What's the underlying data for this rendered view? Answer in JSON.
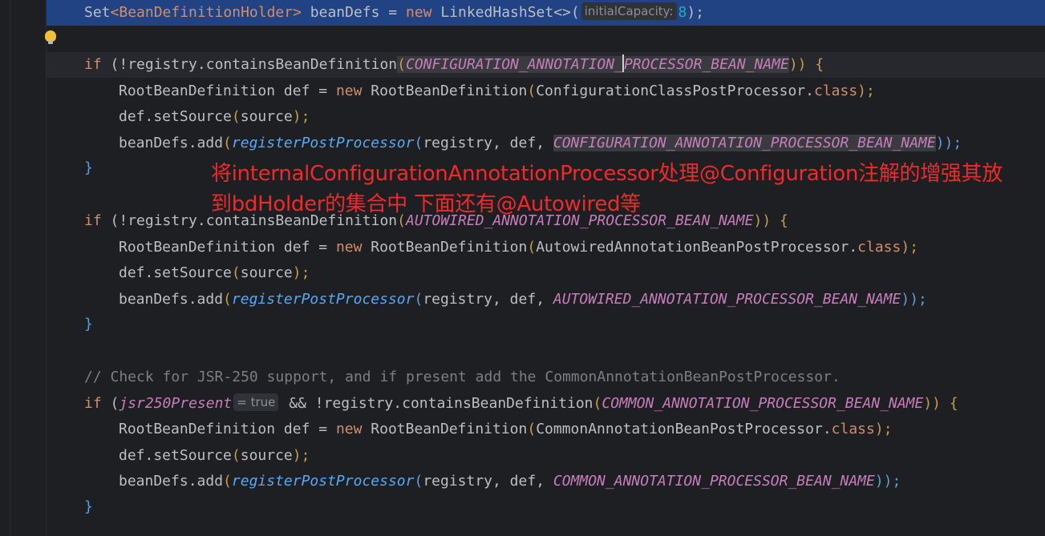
{
  "code": {
    "line1": {
      "set": "Set",
      "generic": "<BeanDefinitionHolder>",
      "decl": " beanDefs = ",
      "new": "new",
      "cls": " LinkedHashSet<>(",
      "hint": "initialCapacity:",
      "num": "8",
      "end": ");"
    },
    "block1": {
      "if": "if",
      "cond_pre": " (!registry.containsBeanDefinition",
      "open": "(",
      "const_a": "CONFIGURATION_ANNOTATION_",
      "const_b": "PROCESSOR_BEAN_NAME",
      "close": ")) {",
      "def_pre": "RootBeanDefinition def = ",
      "new": "new",
      "def_cls": " RootBeanDefinition",
      "def_arg": "ConfigurationClassPostProcessor.",
      "class_kw": "class",
      "def_end": ");",
      "source": "def.setSource",
      "source_arg": "source",
      "source_end": ");",
      "add_pre": "beanDefs.add",
      "reg_fn": "registerPostProcessor",
      "reg_args": "registry, def, ",
      "reg_const": "CONFIGURATION_ANNOTATION_PROCESSOR_BEAN_NAME",
      "add_end": "));",
      "brace": "}"
    },
    "block2": {
      "if": "if",
      "cond_pre": " (!registry.containsBeanDefinition",
      "const": "AUTOWIRED_ANNOTATION_PROCESSOR_BEAN_NAME",
      "close": ")) {",
      "def_pre": "RootBeanDefinition def = ",
      "new": "new",
      "def_cls": " RootBeanDefinition",
      "def_arg": "AutowiredAnnotationBeanPostProcessor.",
      "class_kw": "class",
      "def_end": ");",
      "source": "def.setSource",
      "source_arg": "source",
      "source_end": ");",
      "add_pre": "beanDefs.add",
      "reg_fn": "registerPostProcessor",
      "reg_args": "registry, def, ",
      "reg_const": "AUTOWIRED_ANNOTATION_PROCESSOR_BEAN_NAME",
      "add_end": "));",
      "brace": "}"
    },
    "comment": "// Check for JSR-250 support, and if present add the CommonAnnotationBeanPostProcessor.",
    "block3": {
      "if": "if",
      "jsr": "jsr250Present",
      "hint": "= true",
      "cond_mid": " && !registry.containsBeanDefinition",
      "const": "COMMON_ANNOTATION_PROCESSOR_BEAN_NAME",
      "close": ")) {",
      "def_pre": "RootBeanDefinition def = ",
      "new": "new",
      "def_cls": " RootBeanDefinition",
      "def_arg": "CommonAnnotationBeanPostProcessor.",
      "class_kw": "class",
      "def_end": ");",
      "source": "def.setSource",
      "source_arg": "source",
      "source_end": ");",
      "add_pre": "beanDefs.add",
      "reg_fn": "registerPostProcessor",
      "reg_args": "registry, def, ",
      "reg_const": "COMMON_ANNOTATION_PROCESSOR_BEAN_NAME",
      "add_end": "));",
      "brace": "}"
    }
  },
  "annotation": {
    "line1": "将internalConfigurationAnnotationProcessor处理@Configuration注解的增强其放",
    "line2": "到bdHolder的集合中 下面还有@Autowired等"
  },
  "colors": {
    "background": "#1e1f22",
    "current_line": "#214283",
    "keyword": "#cf8e6d",
    "constant": "#c77dbb",
    "function": "#56a8f5",
    "number": "#2aacb8",
    "annotation_text": "#ee2a2a"
  },
  "icons": {
    "intention": "lightbulb-icon"
  }
}
